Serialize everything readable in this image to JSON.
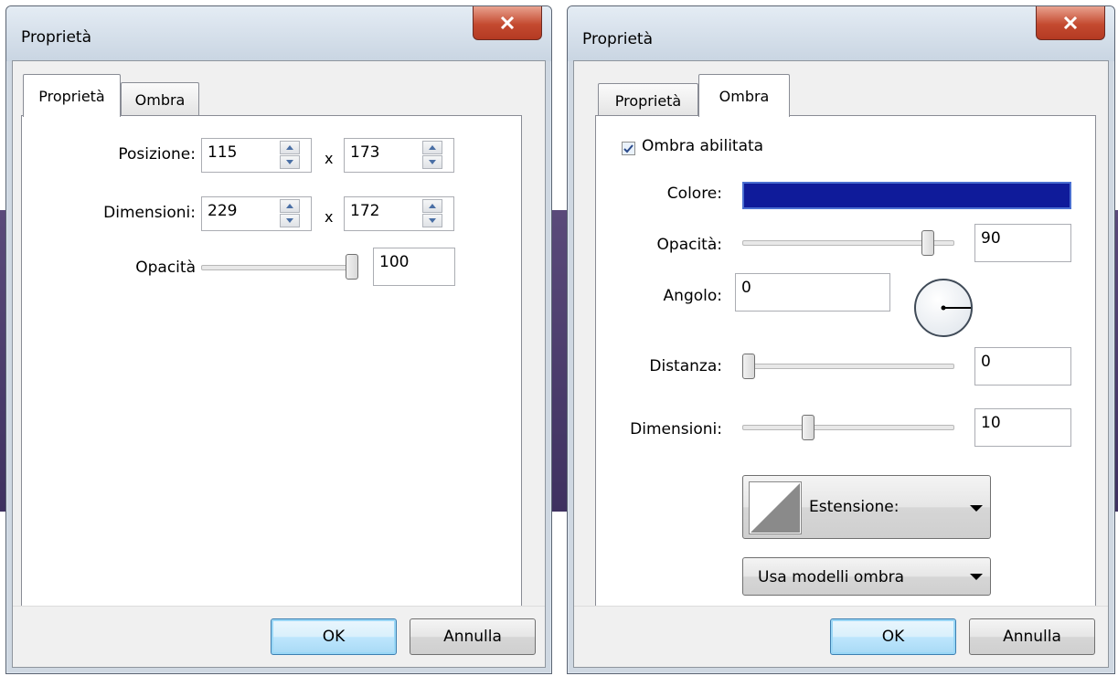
{
  "left_dialog": {
    "title": "Proprietà",
    "tabs": [
      {
        "label": "Proprietà"
      },
      {
        "label": "Ombra"
      }
    ],
    "position": {
      "label": "Posizione:",
      "x_value": "115",
      "separator": "x",
      "y_value": "173"
    },
    "dimensions": {
      "label": "Dimensioni:",
      "width_value": "229",
      "separator": "x",
      "height_value": "172"
    },
    "opacity": {
      "label": "Opacità",
      "value": "100",
      "slider_fraction": 1.0
    },
    "ok_label": "OK",
    "cancel_label": "Annulla"
  },
  "right_dialog": {
    "title": "Proprietà",
    "tabs": [
      {
        "label": "Proprietà"
      },
      {
        "label": "Ombra"
      }
    ],
    "shadow_enabled": {
      "label": "Ombra abilitata",
      "checked": true
    },
    "color": {
      "label": "Colore:",
      "value": "#0f1b9a"
    },
    "opacity": {
      "label": "Opacità:",
      "value": "90",
      "slider_fraction": 0.9
    },
    "angle": {
      "label": "Angolo:",
      "value": "0"
    },
    "distance": {
      "label": "Distanza:",
      "value": "0",
      "slider_fraction": 0.0
    },
    "size": {
      "label": "Dimensioni:",
      "value": "10",
      "slider_fraction": 0.3
    },
    "extension_label": "Estensione:",
    "shadow_models_label": "Usa modelli ombra",
    "ok_label": "OK",
    "cancel_label": "Annulla"
  },
  "colors": {
    "close_button": "#c44a30",
    "shadow_color": "#0f1b9a",
    "default_button": "#bee6fd"
  },
  "icons": {
    "close": "close-icon",
    "spin_up": "spin-up-icon",
    "spin_down": "spin-down-icon",
    "check": "checkmark-icon",
    "dropdown": "dropdown-arrow-icon",
    "extension": "extension-preview-icon"
  }
}
